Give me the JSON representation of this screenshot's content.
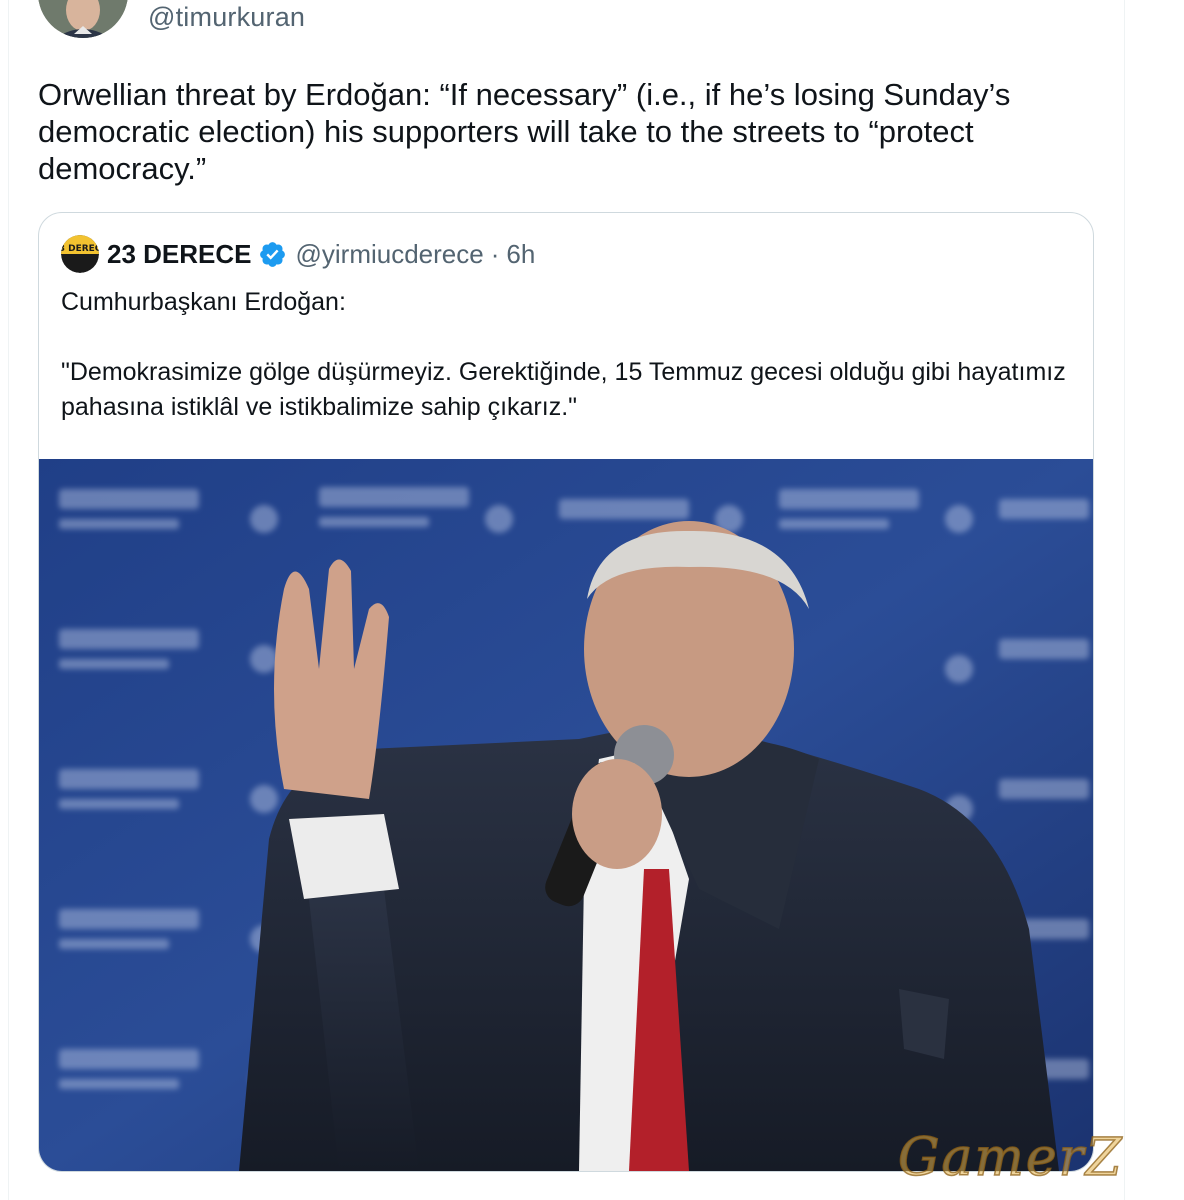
{
  "tweet": {
    "author_handle": "@timurkuran",
    "text": "Orwellian threat by Erdoğan: “If necessary” (i.e., if he’s losing Sunday’s democratic election) his supporters will take to the streets to “protect democracy.”"
  },
  "quoted_tweet": {
    "avatar_text": "23 DERECE",
    "display_name": "23 DERECE",
    "verified": true,
    "handle": "@yirmiucderece",
    "separator": "·",
    "time": "6h",
    "text": "Cumhurbaşkanı Erdoğan:\n\n\"Demokrasimize gölge düşürmeyiz. Gerektiğinde, 15 Temmuz gecesi olduğu gibi hayatımız pahasına istiklâl ve istikbalimize sahip çıkarız.\"",
    "media": {
      "type": "photo",
      "content": "man speaking into a microphone at a rally with a raised hand in front of a blue backdrop"
    }
  },
  "watermark": "GamerZ",
  "colors": {
    "text_primary": "#0f1419",
    "text_secondary": "#536471",
    "border": "#cfd9de",
    "verified_blue": "#1d9bf0",
    "backdrop_blue": "#1d3f86"
  },
  "icons": [
    "verified-badge-icon"
  ]
}
